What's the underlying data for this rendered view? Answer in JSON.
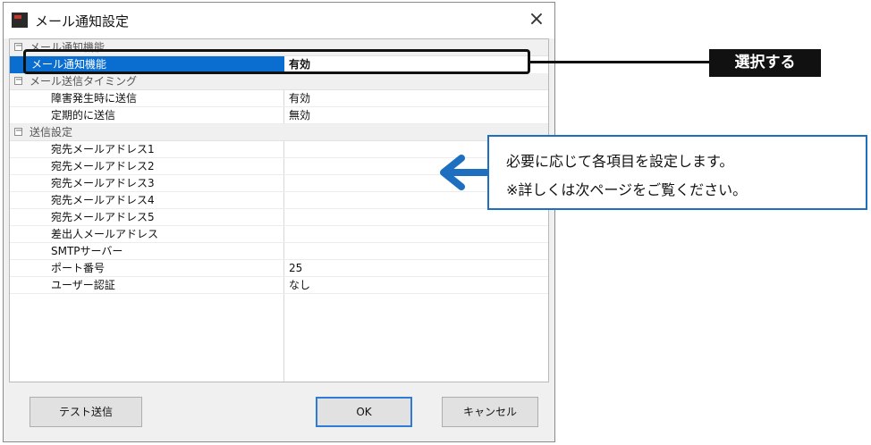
{
  "window": {
    "title": "メール通知設定",
    "close_glyph": "×"
  },
  "grid": {
    "top_category": "メール通知機能",
    "selected": {
      "label": "メール通知機能",
      "value": "有効"
    },
    "hidden_category": "メール送信タイミング",
    "timing_rows": [
      {
        "label": "障害発生時に送信",
        "value": "有効"
      },
      {
        "label": "定期的に送信",
        "value": "無効"
      }
    ],
    "send_category": "送信設定",
    "send_rows": [
      {
        "label": "宛先メールアドレス1",
        "value": ""
      },
      {
        "label": "宛先メールアドレス2",
        "value": ""
      },
      {
        "label": "宛先メールアドレス3",
        "value": ""
      },
      {
        "label": "宛先メールアドレス4",
        "value": ""
      },
      {
        "label": "宛先メールアドレス5",
        "value": ""
      },
      {
        "label": "差出人メールアドレス",
        "value": ""
      },
      {
        "label": "SMTPサーバー",
        "value": ""
      },
      {
        "label": "ポート番号",
        "value": "25"
      },
      {
        "label": "ユーザー認証",
        "value": "なし"
      }
    ],
    "toggle_glyph": "−"
  },
  "buttons": {
    "test": "テスト送信",
    "ok": "OK",
    "cancel": "キャンセル"
  },
  "annotations": {
    "select_label": "選択する",
    "note_line1": "必要に応じて各項目を設定します。",
    "note_line2": "※詳しくは次ページをご覧ください。"
  },
  "colors": {
    "selection": "#0a6ed1",
    "note_border": "#1f6fc0",
    "arrow": "#1f6fc0",
    "ok_border": "#2f7bd6"
  }
}
